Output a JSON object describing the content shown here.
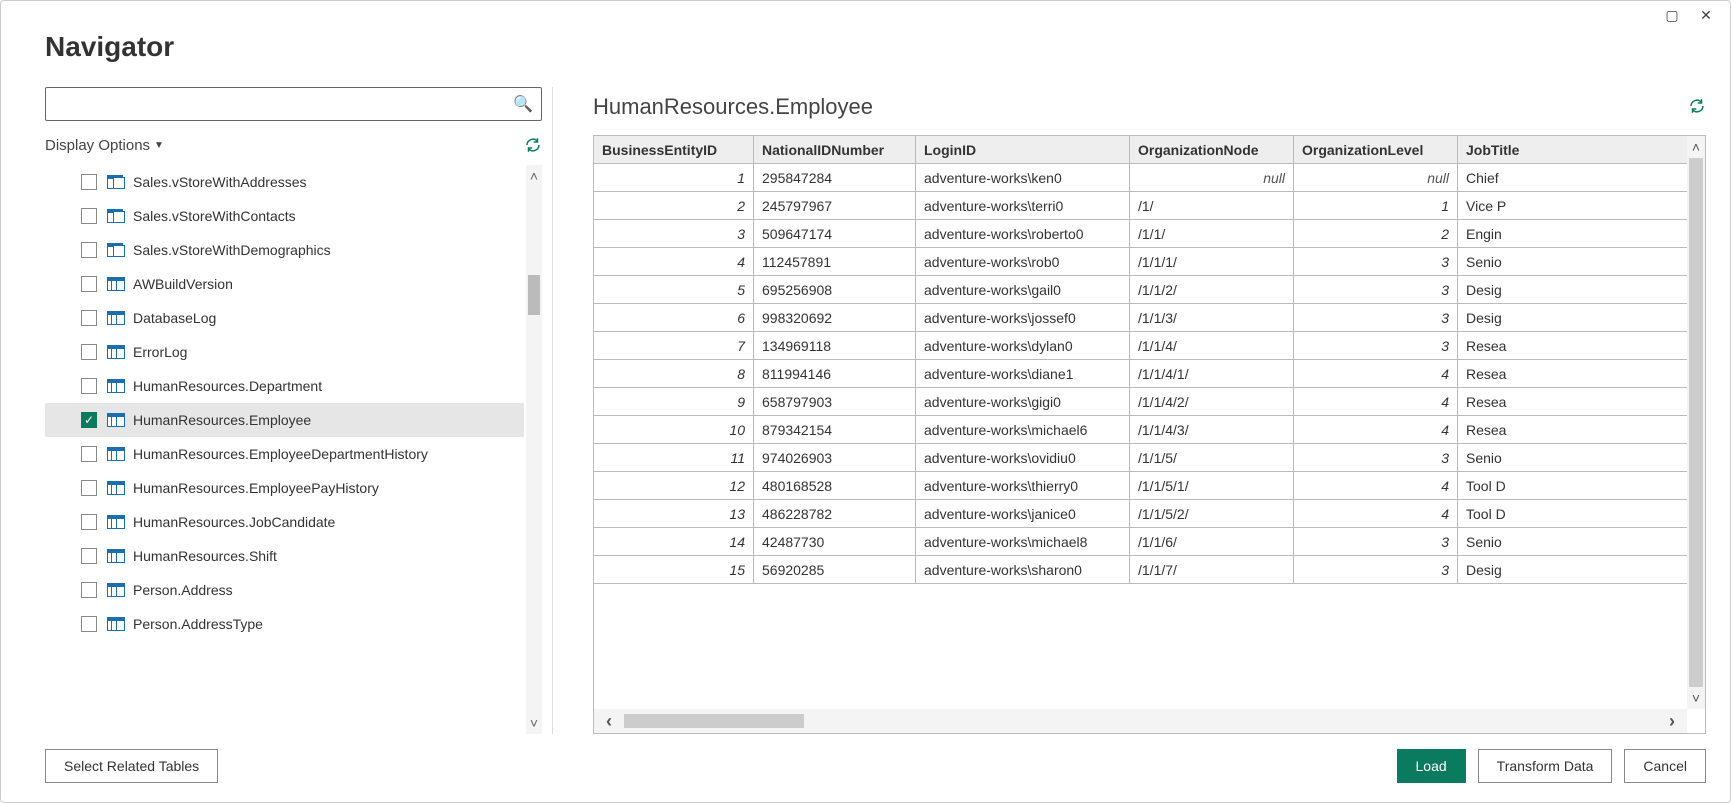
{
  "dialog": {
    "title": "Navigator"
  },
  "left": {
    "search_placeholder": "",
    "display_options": "Display Options",
    "tree": [
      {
        "label": "Sales.vStoreWithAddresses",
        "icon": "view",
        "checked": false,
        "selected": false
      },
      {
        "label": "Sales.vStoreWithContacts",
        "icon": "view",
        "checked": false,
        "selected": false
      },
      {
        "label": "Sales.vStoreWithDemographics",
        "icon": "view",
        "checked": false,
        "selected": false
      },
      {
        "label": "AWBuildVersion",
        "icon": "table",
        "checked": false,
        "selected": false
      },
      {
        "label": "DatabaseLog",
        "icon": "table",
        "checked": false,
        "selected": false
      },
      {
        "label": "ErrorLog",
        "icon": "table",
        "checked": false,
        "selected": false
      },
      {
        "label": "HumanResources.Department",
        "icon": "table",
        "checked": false,
        "selected": false
      },
      {
        "label": "HumanResources.Employee",
        "icon": "table",
        "checked": true,
        "selected": true
      },
      {
        "label": "HumanResources.EmployeeDepartmentHistory",
        "icon": "table",
        "checked": false,
        "selected": false
      },
      {
        "label": "HumanResources.EmployeePayHistory",
        "icon": "table",
        "checked": false,
        "selected": false
      },
      {
        "label": "HumanResources.JobCandidate",
        "icon": "table",
        "checked": false,
        "selected": false
      },
      {
        "label": "HumanResources.Shift",
        "icon": "table",
        "checked": false,
        "selected": false
      },
      {
        "label": "Person.Address",
        "icon": "table",
        "checked": false,
        "selected": false
      },
      {
        "label": "Person.AddressType",
        "icon": "table",
        "checked": false,
        "selected": false
      }
    ]
  },
  "preview": {
    "title": "HumanResources.Employee",
    "columns": [
      "BusinessEntityID",
      "NationalIDNumber",
      "LoginID",
      "OrganizationNode",
      "OrganizationLevel",
      "JobTitle"
    ],
    "rows": [
      [
        "1",
        "295847284",
        "adventure-works\\ken0",
        "null",
        "null",
        "Chief"
      ],
      [
        "2",
        "245797967",
        "adventure-works\\terri0",
        "/1/",
        "1",
        "Vice P"
      ],
      [
        "3",
        "509647174",
        "adventure-works\\roberto0",
        "/1/1/",
        "2",
        "Engin"
      ],
      [
        "4",
        "112457891",
        "adventure-works\\rob0",
        "/1/1/1/",
        "3",
        "Senio"
      ],
      [
        "5",
        "695256908",
        "adventure-works\\gail0",
        "/1/1/2/",
        "3",
        "Desig"
      ],
      [
        "6",
        "998320692",
        "adventure-works\\jossef0",
        "/1/1/3/",
        "3",
        "Desig"
      ],
      [
        "7",
        "134969118",
        "adventure-works\\dylan0",
        "/1/1/4/",
        "3",
        "Resea"
      ],
      [
        "8",
        "811994146",
        "adventure-works\\diane1",
        "/1/1/4/1/",
        "4",
        "Resea"
      ],
      [
        "9",
        "658797903",
        "adventure-works\\gigi0",
        "/1/1/4/2/",
        "4",
        "Resea"
      ],
      [
        "10",
        "879342154",
        "adventure-works\\michael6",
        "/1/1/4/3/",
        "4",
        "Resea"
      ],
      [
        "11",
        "974026903",
        "adventure-works\\ovidiu0",
        "/1/1/5/",
        "3",
        "Senio"
      ],
      [
        "12",
        "480168528",
        "adventure-works\\thierry0",
        "/1/1/5/1/",
        "4",
        "Tool D"
      ],
      [
        "13",
        "486228782",
        "adventure-works\\janice0",
        "/1/1/5/2/",
        "4",
        "Tool D"
      ],
      [
        "14",
        "42487730",
        "adventure-works\\michael8",
        "/1/1/6/",
        "3",
        "Senio"
      ],
      [
        "15",
        "56920285",
        "adventure-works\\sharon0",
        "/1/1/7/",
        "3",
        "Desig"
      ]
    ]
  },
  "footer": {
    "select_related": "Select Related Tables",
    "load": "Load",
    "transform": "Transform Data",
    "cancel": "Cancel"
  }
}
